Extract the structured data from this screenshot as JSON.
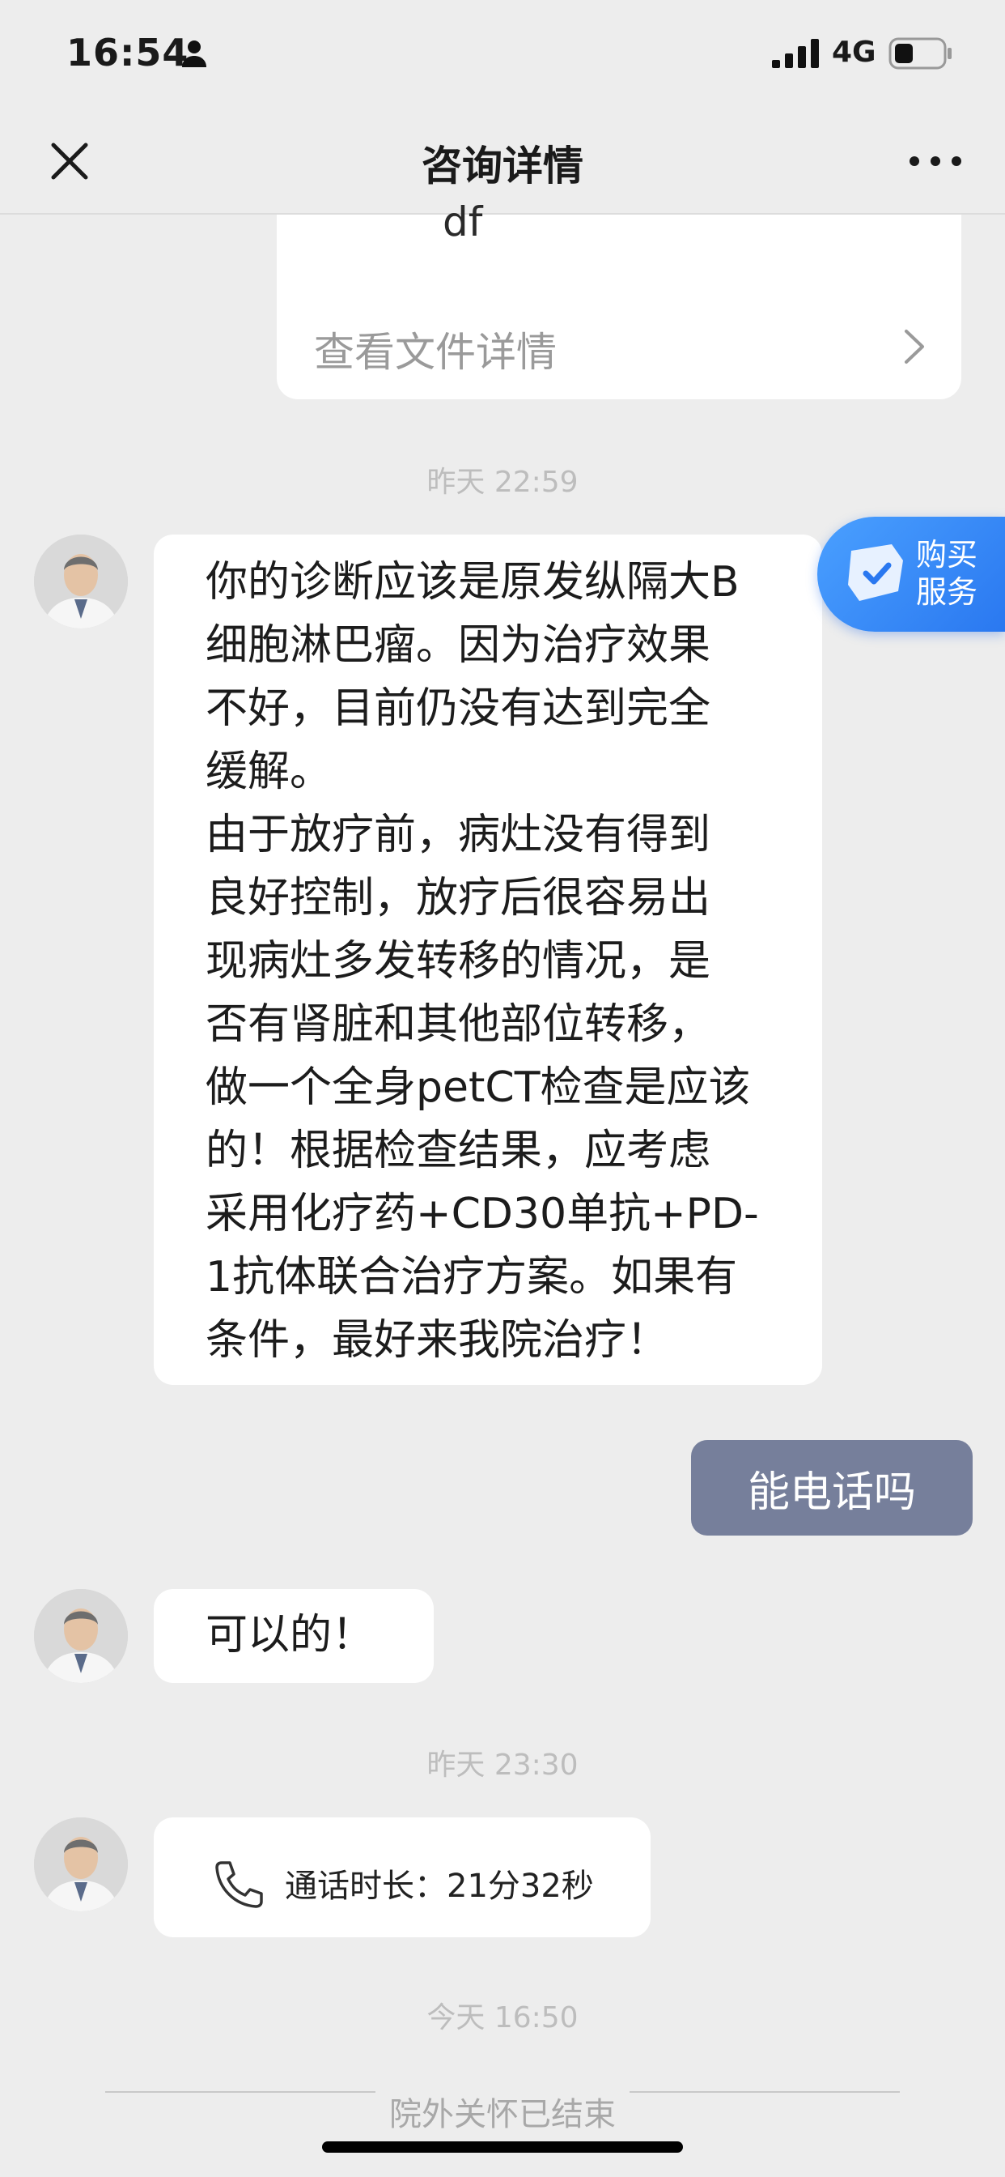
{
  "status_bar": {
    "time": "16:54",
    "network": "4G",
    "icons": [
      "person-icon",
      "signal-icon",
      "battery-icon"
    ]
  },
  "nav": {
    "title": "咨询详情",
    "icons": [
      "close-icon",
      "more-icon"
    ]
  },
  "file_card": {
    "name_tail": "df",
    "link_label": "查看文件详情"
  },
  "timestamps": {
    "t1": "昨天 22:59",
    "t2": "昨天 23:30",
    "t3": "今天 16:50"
  },
  "messages": {
    "doctor_long": "你的诊断应该是原发纵隔大B\n细胞淋巴瘤。因为治疗效果\n不好，目前仍没有达到完全\n缓解。\n由于放疗前，病灶没有得到\n良好控制，放疗后很容易出\n现病灶多发转移的情况，是\n否有肾脏和其他部位转移，\n做一个全身petCT检查是应该\n的！根据检查结果，应考虑\n采用化疗药+CD30单抗+PD-\n1抗体联合治疗方案。如果有\n条件，最好来我院治疗！",
    "user_reply": "能电话吗",
    "doctor_short": "可以的！",
    "call_record": "通话时长：21分32秒"
  },
  "buy_service": {
    "label": "购买\n服务"
  },
  "footer": {
    "ended_text": "院外关怀已结束"
  },
  "colors": {
    "background": "#ededed",
    "user_bubble": "#767f9b",
    "accent": "#2a78f0"
  }
}
